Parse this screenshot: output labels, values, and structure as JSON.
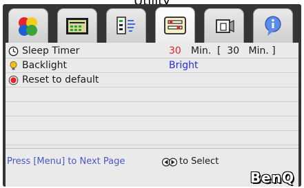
{
  "page_title": "Utility",
  "tabs": [
    {
      "icon": "color-circles-icon",
      "active": false
    },
    {
      "icon": "picture-settings-icon",
      "active": false
    },
    {
      "icon": "signal-source-icon",
      "active": false
    },
    {
      "icon": "utility-settings-icon",
      "active": true
    },
    {
      "icon": "projector-icon",
      "active": false
    },
    {
      "icon": "information-icon",
      "active": false
    }
  ],
  "settings": {
    "sleep_timer": {
      "icon": "clock-icon",
      "label": "Sleep Timer",
      "value": "30",
      "unit": "Min.",
      "bracket_text": "[  30   Min. ]"
    },
    "backlight": {
      "icon": "lightbulb-icon",
      "label": "Backlight",
      "value": "Bright"
    },
    "reset": {
      "icon": "red-button-icon",
      "label": "Reset to default"
    }
  },
  "footer": {
    "hint_menu": "Press [Menu] to Next Page",
    "nav_icon": "left-right-arrows-icon",
    "hint_select": "to Select",
    "brand": "BenQ"
  },
  "colors": {
    "frame": "#343434",
    "panel": "#eaeaea",
    "timer_value": "#e02020",
    "backlight_value": "#2a2adf",
    "hint_text": "#4a56c6"
  }
}
